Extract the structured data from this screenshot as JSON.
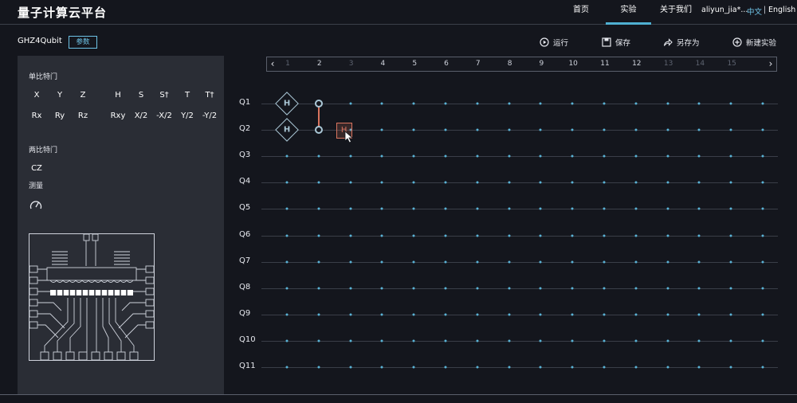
{
  "header": {
    "brand": "量子计算云平台",
    "nav": [
      {
        "label": "首页",
        "active": false
      },
      {
        "label": "实验",
        "active": true
      },
      {
        "label": "关于我们",
        "active": false
      }
    ],
    "user": "aliyun_jia*...",
    "lang_zh": "中文",
    "lang_sep": "|",
    "lang_en": "English"
  },
  "experiment": {
    "title": "GHZ4Qubit",
    "param_label": "参数"
  },
  "toolbar": {
    "run": "运行",
    "save": "保存",
    "save_as": "另存为",
    "new": "新建实验"
  },
  "sidebar": {
    "single_label": "单比特门",
    "single_row1": [
      "X",
      "Y",
      "Z",
      "H",
      "S",
      "S†",
      "T",
      "T†"
    ],
    "single_row2": [
      "Rx",
      "Ry",
      "Rz",
      "Rxy",
      "X/2",
      "-X/2",
      "Y/2",
      "-Y/2"
    ],
    "two_label": "两比特门",
    "two_gates": [
      "CZ"
    ],
    "measure_label": "测量"
  },
  "circuit": {
    "columns": [
      "1",
      "2",
      "3",
      "4",
      "5",
      "6",
      "7",
      "8",
      "9",
      "10",
      "11",
      "12",
      "13",
      "14",
      "15"
    ],
    "qubits": [
      "Q1",
      "Q2",
      "Q3",
      "Q4",
      "Q5",
      "Q6",
      "Q7",
      "Q8",
      "Q9",
      "Q10",
      "Q11"
    ],
    "gates": [
      {
        "type": "H",
        "qubit": 1,
        "column": 1
      },
      {
        "type": "H",
        "qubit": 2,
        "column": 1
      },
      {
        "type": "CZ",
        "qubits": [
          1,
          2
        ],
        "column": 2
      },
      {
        "type": "H",
        "qubit": 2,
        "column": 3,
        "state": "dragging"
      }
    ]
  },
  "colors": {
    "accent": "#4fb0d2",
    "wire_dot": "#5ab3d6",
    "cz_line": "#d9745f",
    "panel": "#2a2d35",
    "background": "#14161d"
  }
}
